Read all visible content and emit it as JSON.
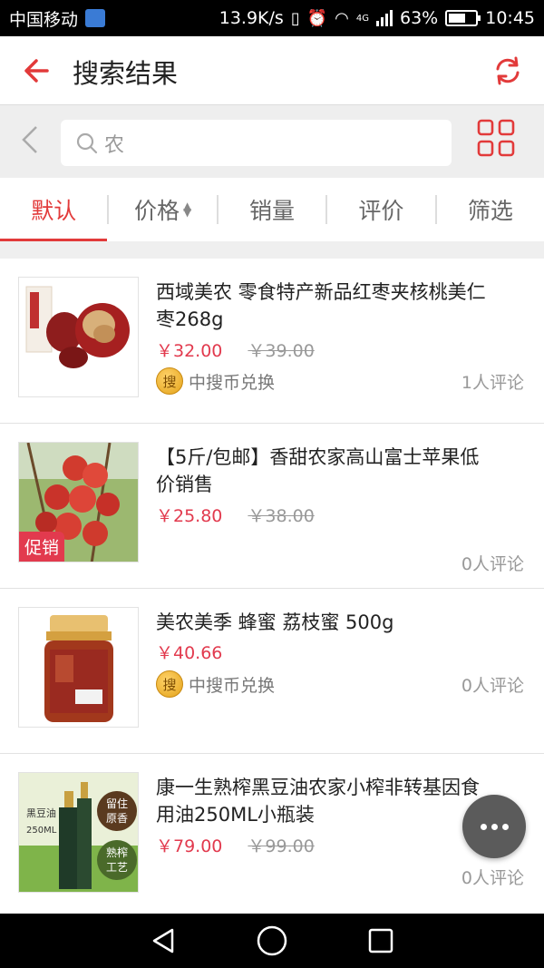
{
  "status_bar": {
    "carrier": "中国移动",
    "speed": "13.9K/s",
    "network": "4G",
    "battery_percent": "63%",
    "battery_level": 0.63,
    "time": "10:45"
  },
  "header": {
    "title": "搜索结果",
    "back_icon": "back-arrow-icon",
    "refresh_icon": "refresh-icon"
  },
  "search": {
    "query": "农"
  },
  "sort_tabs": [
    {
      "label": "默认",
      "active": true
    },
    {
      "label": "价格",
      "active": false
    },
    {
      "label": "销量",
      "active": false
    },
    {
      "label": "评价",
      "active": false
    },
    {
      "label": "筛选",
      "active": false
    }
  ],
  "products": [
    {
      "title": "西域美农 零食特产新品红枣夹核桃美仁枣268g",
      "price": "￥32.00",
      "original_price": "￥39.00",
      "coin_label": "中搜币兑换",
      "coin_glyph": "搜",
      "reviews": "1人评论"
    },
    {
      "title": "【5斤/包邮】香甜农家高山富士苹果低价销售",
      "price": "￥25.80",
      "original_price": "￥38.00",
      "badge": "促销",
      "reviews": "0人评论"
    },
    {
      "title": "美农美季 蜂蜜 荔枝蜜 500g",
      "price": "￥40.66",
      "coin_label": "中搜币兑换",
      "coin_glyph": "搜",
      "reviews": "0人评论"
    },
    {
      "title": "康一生熟榨黑豆油农家小榨非转基因食用油250ML小瓶装",
      "price": "￥79.00",
      "original_price": "￥99.00",
      "reviews": "0人评论",
      "image_text": [
        "留住",
        "原香",
        "熟榨",
        "工艺",
        "黑豆油",
        "250ML"
      ]
    }
  ],
  "colors": {
    "accent": "#e23a3a",
    "price": "#e23a4e",
    "fab": "#5b5b5b"
  }
}
